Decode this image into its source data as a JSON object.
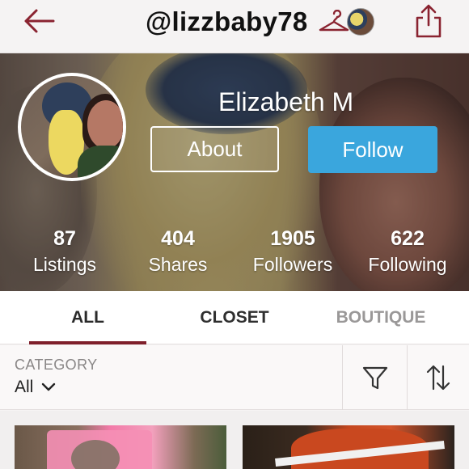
{
  "header": {
    "username": "@lizzbaby78",
    "icons": {
      "back": "back-arrow-icon",
      "hanger": "hanger-icon",
      "share": "share-icon"
    }
  },
  "profile": {
    "name": "Elizabeth M",
    "about_label": "About",
    "follow_label": "Follow",
    "stats": [
      {
        "value": "87",
        "label": "Listings"
      },
      {
        "value": "404",
        "label": "Shares"
      },
      {
        "value": "1905",
        "label": "Followers"
      },
      {
        "value": "622",
        "label": "Following"
      }
    ]
  },
  "tabs": [
    {
      "label": "ALL",
      "active": true
    },
    {
      "label": "CLOSET",
      "active": false
    },
    {
      "label": "BOUTIQUE",
      "active": false
    }
  ],
  "filter": {
    "category_label": "CATEGORY",
    "category_value": "All",
    "icons": {
      "filter": "funnel-icon",
      "sort": "sort-arrows-icon"
    }
  },
  "colors": {
    "accent": "#7f1f2b",
    "follow_button": "#3aa6dd"
  }
}
